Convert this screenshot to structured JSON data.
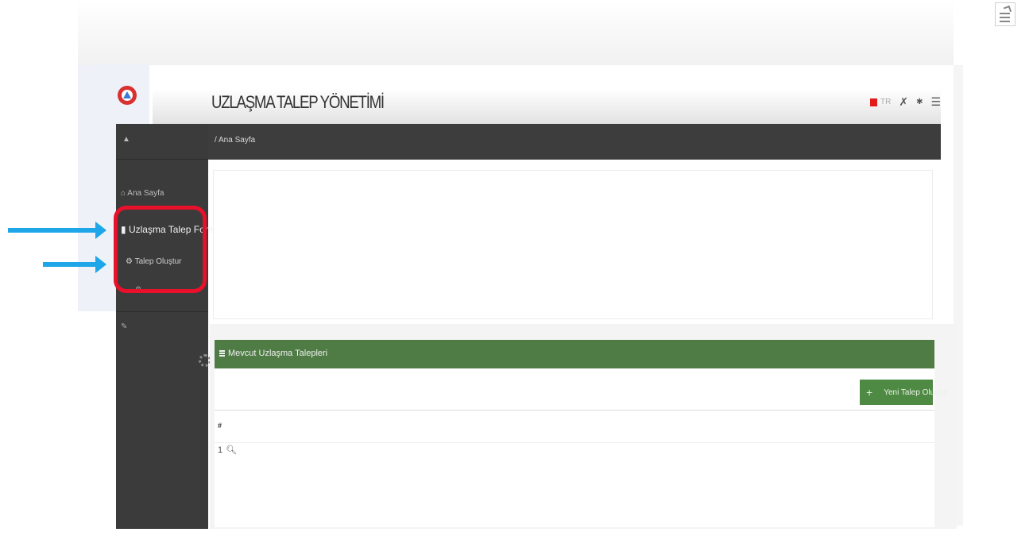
{
  "app": {
    "title": "UZLAŞMA TALEP YÖNETİMİ",
    "language": "TR",
    "brand_color": "#d93030"
  },
  "header_icons": [
    "flag-icon",
    "tools-icon",
    "star-icon",
    "menu-icon"
  ],
  "sidebar": {
    "user": "",
    "items": [
      {
        "label": "Ana Sayfa",
        "icon": "home-icon"
      },
      {
        "label": "Uzlaşma Talep Formu",
        "icon": "file-icon",
        "active": true
      },
      {
        "label": "Talep Oluştur",
        "icon": "gear-icon",
        "sub": true
      },
      {
        "label": "",
        "icon": "gear-icon",
        "sub": true
      },
      {
        "label": "",
        "icon": "wrench-icon"
      }
    ]
  },
  "breadcrumb": {
    "parent": "",
    "current": "Ana Sayfa"
  },
  "info": {
    "left": "",
    "right": ""
  },
  "table": {
    "title": "Mevcut Uzlaşma Talepleri",
    "new_button": "Yeni Talep Oluştur",
    "columns": [
      "#",
      "",
      "",
      "",
      "",
      ""
    ],
    "rows": [
      {
        "index": "1",
        "action_icon": "search-icon"
      }
    ]
  },
  "colors": {
    "sidebar": "#3b3b3b",
    "table_header": "#4f7c45",
    "highlight": "#e8102a",
    "arrow": "#1ea6e8"
  }
}
